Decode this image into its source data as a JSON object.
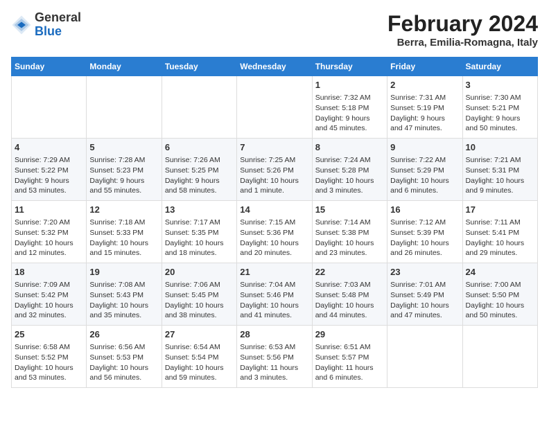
{
  "header": {
    "logo_general": "General",
    "logo_blue": "Blue",
    "month_title": "February 2024",
    "location": "Berra, Emilia-Romagna, Italy"
  },
  "days_of_week": [
    "Sunday",
    "Monday",
    "Tuesday",
    "Wednesday",
    "Thursday",
    "Friday",
    "Saturday"
  ],
  "weeks": [
    [
      {
        "day": "",
        "info": ""
      },
      {
        "day": "",
        "info": ""
      },
      {
        "day": "",
        "info": ""
      },
      {
        "day": "",
        "info": ""
      },
      {
        "day": "1",
        "info": "Sunrise: 7:32 AM\nSunset: 5:18 PM\nDaylight: 9 hours\nand 45 minutes."
      },
      {
        "day": "2",
        "info": "Sunrise: 7:31 AM\nSunset: 5:19 PM\nDaylight: 9 hours\nand 47 minutes."
      },
      {
        "day": "3",
        "info": "Sunrise: 7:30 AM\nSunset: 5:21 PM\nDaylight: 9 hours\nand 50 minutes."
      }
    ],
    [
      {
        "day": "4",
        "info": "Sunrise: 7:29 AM\nSunset: 5:22 PM\nDaylight: 9 hours\nand 53 minutes."
      },
      {
        "day": "5",
        "info": "Sunrise: 7:28 AM\nSunset: 5:23 PM\nDaylight: 9 hours\nand 55 minutes."
      },
      {
        "day": "6",
        "info": "Sunrise: 7:26 AM\nSunset: 5:25 PM\nDaylight: 9 hours\nand 58 minutes."
      },
      {
        "day": "7",
        "info": "Sunrise: 7:25 AM\nSunset: 5:26 PM\nDaylight: 10 hours\nand 1 minute."
      },
      {
        "day": "8",
        "info": "Sunrise: 7:24 AM\nSunset: 5:28 PM\nDaylight: 10 hours\nand 3 minutes."
      },
      {
        "day": "9",
        "info": "Sunrise: 7:22 AM\nSunset: 5:29 PM\nDaylight: 10 hours\nand 6 minutes."
      },
      {
        "day": "10",
        "info": "Sunrise: 7:21 AM\nSunset: 5:31 PM\nDaylight: 10 hours\nand 9 minutes."
      }
    ],
    [
      {
        "day": "11",
        "info": "Sunrise: 7:20 AM\nSunset: 5:32 PM\nDaylight: 10 hours\nand 12 minutes."
      },
      {
        "day": "12",
        "info": "Sunrise: 7:18 AM\nSunset: 5:33 PM\nDaylight: 10 hours\nand 15 minutes."
      },
      {
        "day": "13",
        "info": "Sunrise: 7:17 AM\nSunset: 5:35 PM\nDaylight: 10 hours\nand 18 minutes."
      },
      {
        "day": "14",
        "info": "Sunrise: 7:15 AM\nSunset: 5:36 PM\nDaylight: 10 hours\nand 20 minutes."
      },
      {
        "day": "15",
        "info": "Sunrise: 7:14 AM\nSunset: 5:38 PM\nDaylight: 10 hours\nand 23 minutes."
      },
      {
        "day": "16",
        "info": "Sunrise: 7:12 AM\nSunset: 5:39 PM\nDaylight: 10 hours\nand 26 minutes."
      },
      {
        "day": "17",
        "info": "Sunrise: 7:11 AM\nSunset: 5:41 PM\nDaylight: 10 hours\nand 29 minutes."
      }
    ],
    [
      {
        "day": "18",
        "info": "Sunrise: 7:09 AM\nSunset: 5:42 PM\nDaylight: 10 hours\nand 32 minutes."
      },
      {
        "day": "19",
        "info": "Sunrise: 7:08 AM\nSunset: 5:43 PM\nDaylight: 10 hours\nand 35 minutes."
      },
      {
        "day": "20",
        "info": "Sunrise: 7:06 AM\nSunset: 5:45 PM\nDaylight: 10 hours\nand 38 minutes."
      },
      {
        "day": "21",
        "info": "Sunrise: 7:04 AM\nSunset: 5:46 PM\nDaylight: 10 hours\nand 41 minutes."
      },
      {
        "day": "22",
        "info": "Sunrise: 7:03 AM\nSunset: 5:48 PM\nDaylight: 10 hours\nand 44 minutes."
      },
      {
        "day": "23",
        "info": "Sunrise: 7:01 AM\nSunset: 5:49 PM\nDaylight: 10 hours\nand 47 minutes."
      },
      {
        "day": "24",
        "info": "Sunrise: 7:00 AM\nSunset: 5:50 PM\nDaylight: 10 hours\nand 50 minutes."
      }
    ],
    [
      {
        "day": "25",
        "info": "Sunrise: 6:58 AM\nSunset: 5:52 PM\nDaylight: 10 hours\nand 53 minutes."
      },
      {
        "day": "26",
        "info": "Sunrise: 6:56 AM\nSunset: 5:53 PM\nDaylight: 10 hours\nand 56 minutes."
      },
      {
        "day": "27",
        "info": "Sunrise: 6:54 AM\nSunset: 5:54 PM\nDaylight: 10 hours\nand 59 minutes."
      },
      {
        "day": "28",
        "info": "Sunrise: 6:53 AM\nSunset: 5:56 PM\nDaylight: 11 hours\nand 3 minutes."
      },
      {
        "day": "29",
        "info": "Sunrise: 6:51 AM\nSunset: 5:57 PM\nDaylight: 11 hours\nand 6 minutes."
      },
      {
        "day": "",
        "info": ""
      },
      {
        "day": "",
        "info": ""
      }
    ]
  ]
}
